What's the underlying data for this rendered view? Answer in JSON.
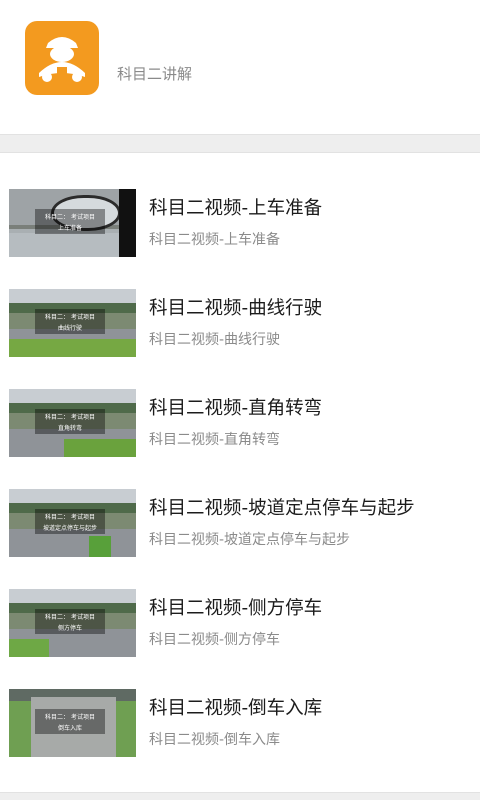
{
  "app": {
    "subtitle": "科目二讲解"
  },
  "items": [
    {
      "title": "科目二视频-上车准备",
      "desc": "科目二视频-上车准备",
      "overlay_line1": "科目二： 考试项目",
      "overlay_line2": "上车准备"
    },
    {
      "title": "科目二视频-曲线行驶",
      "desc": "科目二视频-曲线行驶",
      "overlay_line1": "科目二： 考试项目",
      "overlay_line2": "曲线行驶"
    },
    {
      "title": "科目二视频-直角转弯",
      "desc": "科目二视频-直角转弯",
      "overlay_line1": "科目二： 考试项目",
      "overlay_line2": "直角转弯"
    },
    {
      "title": "科目二视频-坡道定点停车与起步",
      "desc": "科目二视频-坡道定点停车与起步",
      "overlay_line1": "科目二： 考试项目",
      "overlay_line2": "坡道定点停车与起步"
    },
    {
      "title": "科目二视频-侧方停车",
      "desc": "科目二视频-侧方停车",
      "overlay_line1": "科目二： 考试项目",
      "overlay_line2": "侧方停车"
    },
    {
      "title": "科目二视频-倒车入库",
      "desc": "科目二视频-倒车入库",
      "overlay_line1": "科目二： 考试项目",
      "overlay_line2": "倒车入库"
    }
  ],
  "icons": {
    "app_icon": "driver-icon"
  },
  "colors": {
    "app_icon_bg": "#f39a1f",
    "title": "#1c1c1c",
    "desc": "#8b8b8b",
    "divider": "#eeeeee"
  }
}
